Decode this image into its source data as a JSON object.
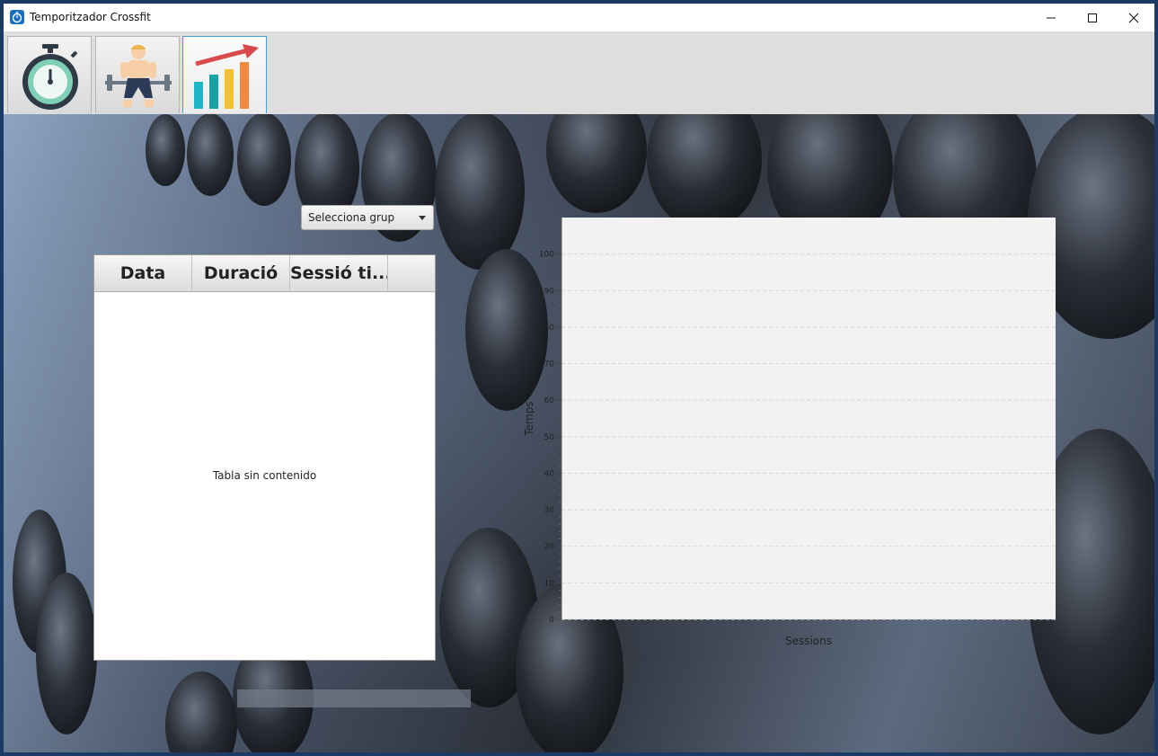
{
  "window": {
    "title": "Temporitzador Crossfit",
    "controls": {
      "minimize": "minimize-icon",
      "maximize": "maximize-icon",
      "close": "close-icon"
    }
  },
  "tabs": [
    {
      "icon": "stopwatch-icon",
      "active": false
    },
    {
      "icon": "weightlifter-icon",
      "active": false
    },
    {
      "icon": "bar-chart-growth-icon",
      "active": true
    }
  ],
  "group_selector": {
    "placeholder": "Selecciona grup"
  },
  "sessions_table": {
    "columns": [
      "Data",
      "Duració",
      "Sessió ti..."
    ],
    "empty_message": "Tabla sin contenido"
  },
  "chart_data": {
    "type": "bar",
    "categories": [],
    "series": [],
    "xlabel": "Sessions",
    "ylabel": "Temps",
    "ylim": [
      0,
      110
    ],
    "y_ticks": [
      "0",
      "10",
      "20",
      "30",
      "40",
      "50",
      "60",
      "70",
      "80",
      "90",
      "100"
    ],
    "grid": true
  },
  "colors": {
    "accent": "#3fa0d8",
    "plot_background": "#f2f2f2",
    "bar_teal": "#1fb5c4",
    "bar_yellow": "#f3c02e",
    "bar_orange": "#f08a3e",
    "arrow_red": "#d9484a"
  }
}
